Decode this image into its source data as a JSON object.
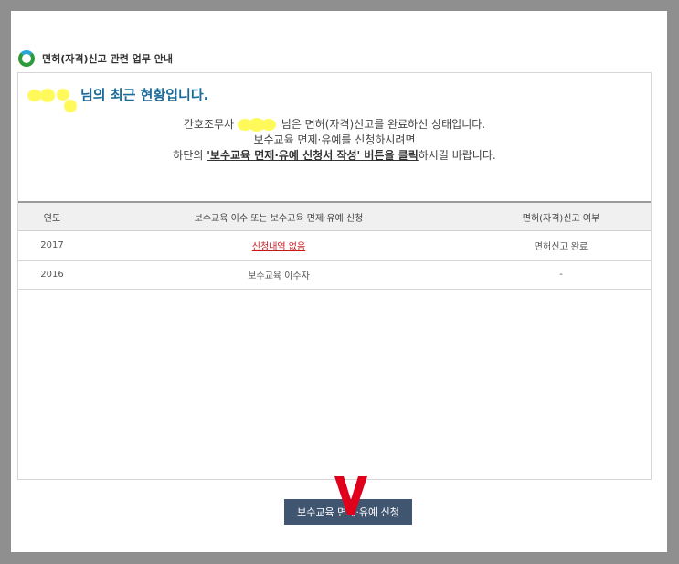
{
  "header": {
    "title": "면허(자격)신고 관련 업무 안내",
    "logo_icon": "ring-logo-icon"
  },
  "headline": {
    "suffix": "님의 최근 현황입니다."
  },
  "info": {
    "line1_prefix": "간호조무사",
    "line1_suffix": "님은 면허(자격)신고를 완료하신 상태입니다.",
    "line2": "보수교육 면제·유예를 신청하시려면",
    "line3_prefix": "하단의 ",
    "line3_strong": "'보수교육 면제·유예 신청서 작성' 버튼을 클릭",
    "line3_suffix": "하시길 바랍니다."
  },
  "table": {
    "headers": [
      "연도",
      "보수교육 이수 또는 보수교육 면제·유예 신청",
      "면허(자격)신고 여부"
    ],
    "rows": [
      {
        "year": "2017",
        "status": "신청내역 없음",
        "report": "면허신고 완료"
      },
      {
        "year": "2016",
        "status": "보수교육 이수자",
        "report": "-"
      }
    ]
  },
  "button": {
    "label": "보수교육 면제·유예 신청"
  },
  "colors": {
    "accent_blue": "#1b6a9a",
    "link_red": "#c8191f",
    "button_bg": "#3f5570",
    "redaction": "#fff95a",
    "annotation": "#e0001b"
  }
}
